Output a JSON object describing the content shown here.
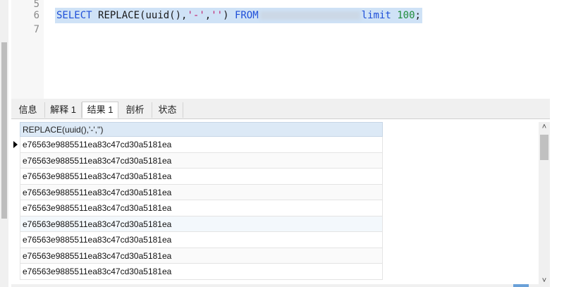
{
  "editor": {
    "line_numbers": [
      "5",
      "6",
      "7"
    ],
    "code": {
      "kw_select": "SELECT",
      "fn_replace": "REPLACE",
      "paren_open": "(uuid(),",
      "str1": "'-'",
      "comma": ",",
      "str2": "''",
      "paren_close": ")",
      "kw_from": "FROM",
      "kw_limit": "limit",
      "num": "100",
      "semicolon": ";"
    }
  },
  "tabs": [
    {
      "label": "信息"
    },
    {
      "label": "解释 1"
    },
    {
      "label": "结果 1",
      "active": true
    },
    {
      "label": "剖析"
    },
    {
      "label": "状态"
    }
  ],
  "result": {
    "column_header": "REPLACE(uuid(),'-','')",
    "rows": [
      "e76563e9885511ea83c47cd30a5181ea",
      "e76563e9885511ea83c47cd30a5181ea",
      "e76563e9885511ea83c47cd30a5181ea",
      "e76563e9885511ea83c47cd30a5181ea",
      "e76563e9885511ea83c47cd30a5181ea",
      "e76563e9885511ea83c47cd30a5181ea",
      "e76563e9885511ea83c47cd30a5181ea",
      "e76563e9885511ea83c47cd30a5181ea",
      "e76563e9885511ea83c47cd30a5181ea"
    ]
  },
  "icons": {
    "scroll_up": "chevron-up-icon",
    "scroll_down": "chevron-down-icon",
    "row_marker": "current-row-arrow-icon"
  },
  "colors": {
    "keyword": "#1f4fd8",
    "string": "#c0206f",
    "number": "#1f8c3a",
    "selection": "#cfe2f6",
    "grid_header": "#dce9f6"
  }
}
